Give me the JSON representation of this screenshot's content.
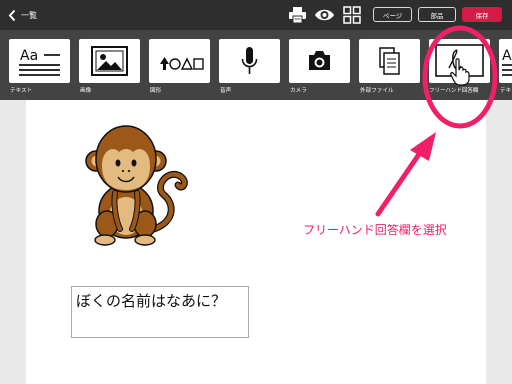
{
  "header": {
    "back_label": "一覧",
    "page_button": "ページ",
    "parts_button": "部品",
    "save_button": "保存"
  },
  "toolbar": {
    "tools": [
      {
        "label": "テキスト",
        "icon": "text-icon"
      },
      {
        "label": "画像",
        "icon": "image-icon"
      },
      {
        "label": "図形",
        "icon": "shapes-icon"
      },
      {
        "label": "音声",
        "icon": "microphone-icon"
      },
      {
        "label": "カメラ",
        "icon": "camera-icon"
      },
      {
        "label": "外部ファイル",
        "icon": "external-file-icon"
      },
      {
        "label": "フリーハンド回答欄",
        "icon": "freehand-answer-icon"
      },
      {
        "label": "テキ",
        "icon": "text-icon"
      }
    ]
  },
  "document": {
    "question": "ぼくの名前はなあに？"
  },
  "annotation": {
    "text": "フリーハンド回答欄を選択",
    "color": "#ef1f68"
  },
  "colors": {
    "topbar": "#2e2e2e",
    "toolbar": "#434344",
    "save_button": "#d71a45",
    "annotation": "#ef1f68"
  }
}
